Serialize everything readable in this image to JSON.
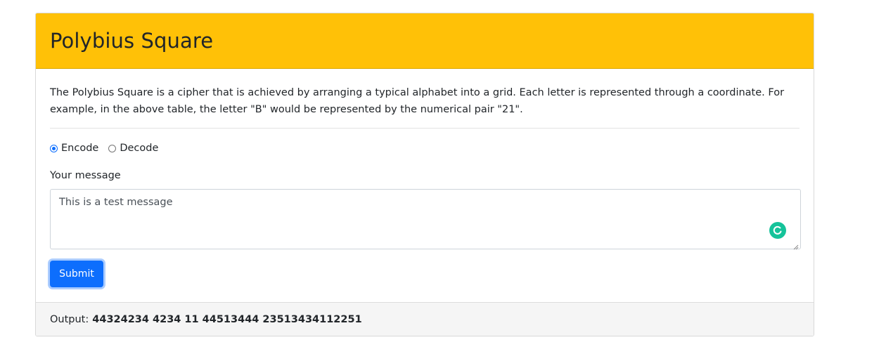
{
  "header": {
    "title": "Polybius Square"
  },
  "description": "The Polybius Square is a cipher that is achieved by arranging a typical alphabet into a grid. Each letter is represented through a coordinate. For example, in the above table, the letter \"B\" would be represented by the numerical pair \"21\".",
  "mode": {
    "options": [
      {
        "label": "Encode",
        "checked": true
      },
      {
        "label": "Decode",
        "checked": false
      }
    ]
  },
  "message": {
    "label": "Your message",
    "value": "This is a test message"
  },
  "submit": {
    "label": "Submit"
  },
  "output": {
    "label": "Output:",
    "value": "44324234 4234 11 44513444 23513434112251"
  },
  "colors": {
    "header_bg": "#ffc107",
    "accent": "#0d6efd",
    "grammarly": "#15c39a"
  },
  "icons": {
    "grammarly": "grammarly-icon",
    "resize": "resize-handle-icon"
  }
}
